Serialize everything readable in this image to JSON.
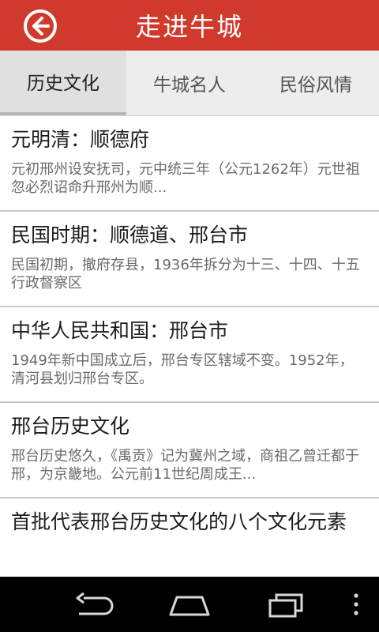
{
  "header": {
    "title": "走进牛城"
  },
  "tabs": [
    {
      "label": "历史文化",
      "active": true
    },
    {
      "label": "牛城名人",
      "active": false
    },
    {
      "label": "民俗风情",
      "active": false
    }
  ],
  "items": [
    {
      "title": "元明清：顺德府",
      "desc": "元初邢州设安抚司，元中统三年（公元1262年）元世祖忽必烈诏命升邢州为顺..."
    },
    {
      "title": "民国时期：顺德道、邢台市",
      "desc": "民国初期，撤府存县，1936年拆分为十三、十四、十五行政督察区"
    },
    {
      "title": "中华人民共和国：邢台市",
      "desc": "1949年新中国成立后，邢台专区辖域不变。1952年，清河县划归邢台专区。"
    },
    {
      "title": "邢台历史文化",
      "desc": "邢台历史悠久，《禹贡》记为冀州之域，商祖乙曾迁都于邢，为京畿地。公元前11世纪周成王..."
    },
    {
      "title": "首批代表邢台历史文化的八个文化元素",
      "desc": ""
    }
  ],
  "colors": {
    "header_bg": "#cf3a2c",
    "tab_bg": "#ededed",
    "tab_active_bg": "#e0e0e0"
  },
  "icons": {
    "back": "back-arrow-circle-icon",
    "nav_back": "nav-back-icon",
    "nav_home": "nav-home-icon",
    "nav_recents": "nav-recents-icon",
    "nav_menu": "nav-menu-icon"
  }
}
